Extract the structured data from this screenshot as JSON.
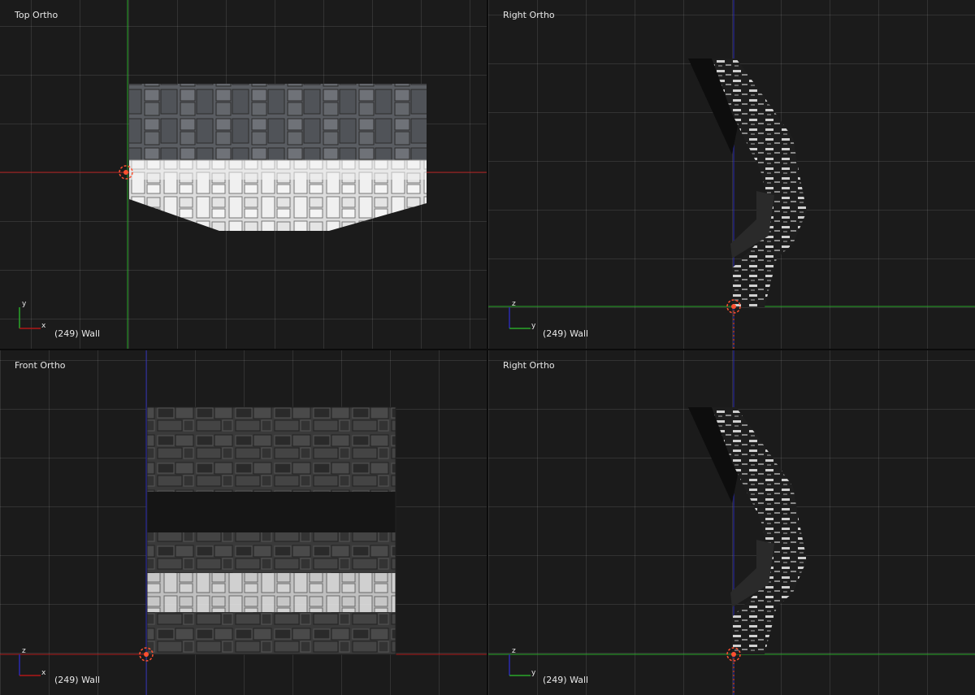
{
  "viewports": {
    "top": {
      "title": "Top Ortho",
      "status": "(249) Wall",
      "axis_a": "y",
      "axis_b": "x"
    },
    "right1": {
      "title": "Right Ortho",
      "status": "(249) Wall",
      "axis_a": "z",
      "axis_b": "y"
    },
    "front": {
      "title": "Front Ortho",
      "status": "(249) Wall",
      "axis_a": "z",
      "axis_b": "x"
    },
    "right2": {
      "title": "Right Ortho",
      "status": "(249) Wall",
      "axis_a": "z",
      "axis_b": "y"
    }
  },
  "colors": {
    "background": "#1b1b1b",
    "grid": "#3a3a3a",
    "x_axis": "#b01818",
    "y_axis": "#2aa82a",
    "z_axis": "#2a2ab0",
    "origin": "#ff5030"
  },
  "icons": [
    "axis-gizmo-icon",
    "object-origin-icon"
  ]
}
